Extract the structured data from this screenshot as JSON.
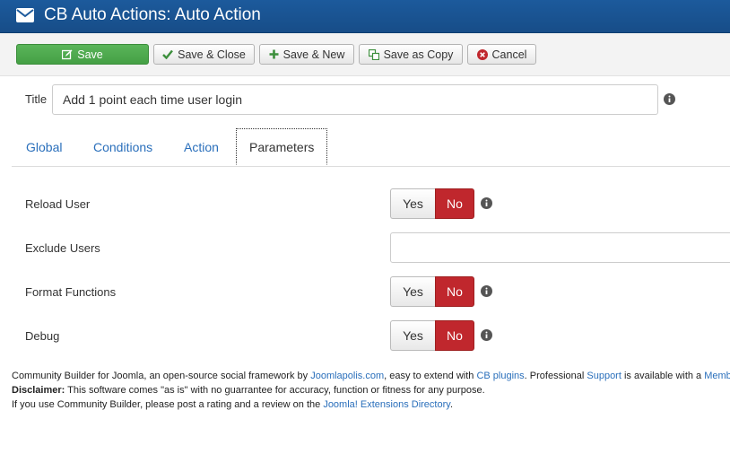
{
  "header": {
    "title": "CB Auto Actions: Auto Action"
  },
  "toolbar": {
    "save": "Save",
    "save_close": "Save & Close",
    "save_new": "Save & New",
    "save_copy": "Save as Copy",
    "cancel": "Cancel"
  },
  "form": {
    "title_label": "Title",
    "title_value": "Add 1 point each time user login"
  },
  "tabs": [
    {
      "label": "Global"
    },
    {
      "label": "Conditions"
    },
    {
      "label": "Action"
    },
    {
      "label": "Parameters",
      "active": true
    }
  ],
  "params": {
    "reload_user": {
      "label": "Reload User",
      "yes": "Yes",
      "no": "No",
      "selected": "No"
    },
    "exclude_users": {
      "label": "Exclude Users",
      "value": ""
    },
    "format_functions": {
      "label": "Format Functions",
      "yes": "Yes",
      "no": "No",
      "selected": "No"
    },
    "debug": {
      "label": "Debug",
      "yes": "Yes",
      "no": "No",
      "selected": "No"
    }
  },
  "footer": {
    "line1_a": "Community Builder for Joomla, an open-source social framework by ",
    "link_joomlapolis": "Joomlapolis.com",
    "line1_b": ", easy to extend with ",
    "link_cb_plugins": "CB plugins",
    "line1_c": ". Professional ",
    "link_support": "Support",
    "line1_d": " is available with a ",
    "link_membership": "Membe",
    "disclaimer_label": "Disclaimer:",
    "disclaimer_text": " This software comes \"as is\" with no guarrantee for accuracy, function or fitness for any purpose.",
    "line3_a": "If you use Community Builder, please post a rating and a review on the ",
    "link_jed": "Joomla! Extensions Directory",
    "line3_b": "."
  },
  "colors": {
    "header_bg": "#1c5a9c",
    "save_green": "#45a045",
    "no_red": "#c0272d",
    "link_blue": "#2a6fbb"
  }
}
